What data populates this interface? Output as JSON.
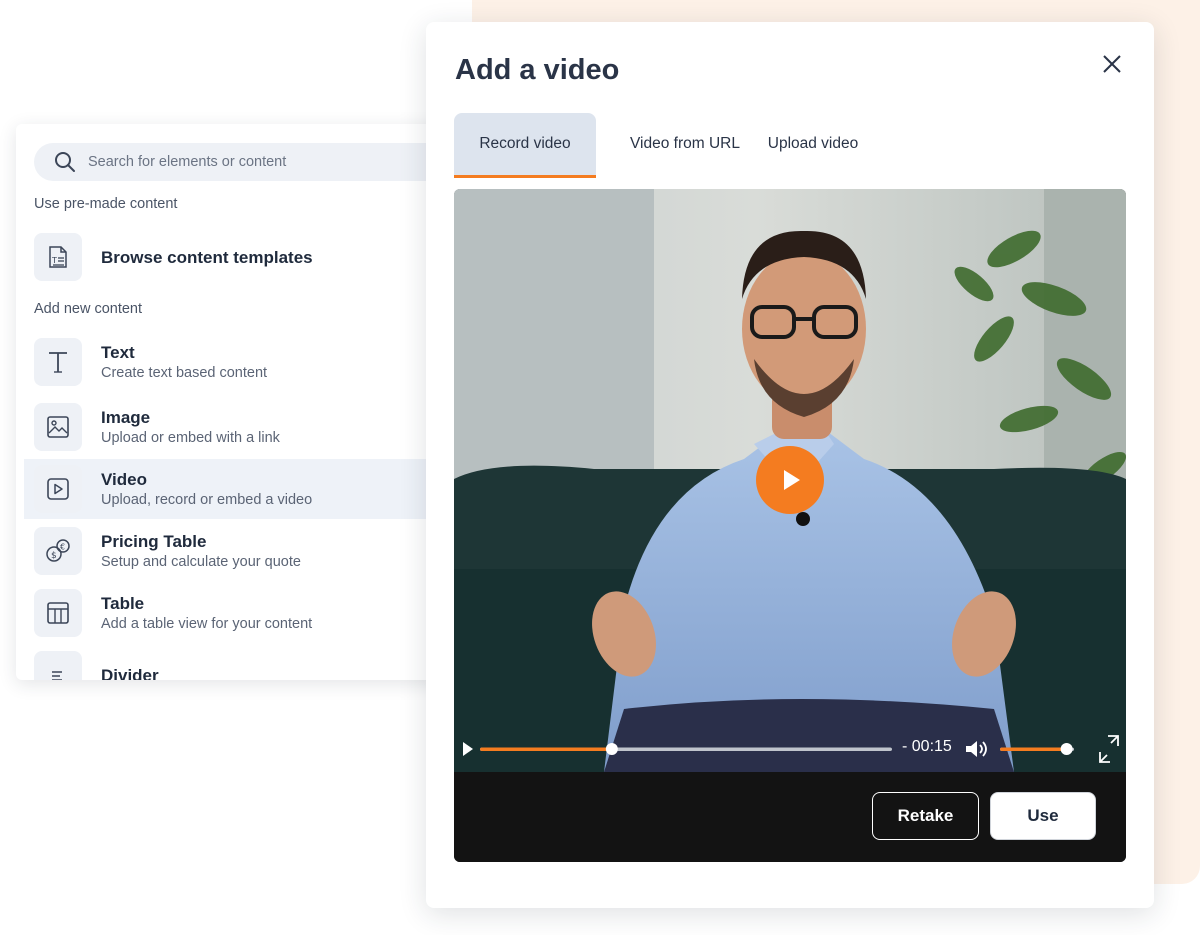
{
  "left_panel": {
    "search": {
      "placeholder": "Search for elements or content"
    },
    "premade_label": "Use pre-made content",
    "templates_label": "Browse content templates",
    "new_label": "Add new content",
    "items": [
      {
        "title": "Text",
        "desc": "Create text based content",
        "icon": "text-icon"
      },
      {
        "title": "Image",
        "desc": "Upload or embed with a link",
        "icon": "image-icon"
      },
      {
        "title": "Video",
        "desc": "Upload, record or embed a video",
        "icon": "video-icon"
      },
      {
        "title": "Pricing Table",
        "desc": "Setup and calculate your quote",
        "icon": "pricing-icon"
      },
      {
        "title": "Table",
        "desc": "Add a table view for your content",
        "icon": "table-icon"
      },
      {
        "title": "Divider",
        "desc": "",
        "icon": "divider-icon"
      }
    ]
  },
  "modal": {
    "title": "Add a video",
    "tabs": [
      {
        "label": "Record video",
        "active": true
      },
      {
        "label": "Video from URL",
        "active": false
      },
      {
        "label": "Upload video",
        "active": false
      }
    ],
    "player": {
      "time_remaining": "- 00:15",
      "progress": 0.32,
      "volume": 0.9
    },
    "buttons": {
      "retake": "Retake",
      "use": "Use"
    }
  },
  "colors": {
    "accent": "#f47c20",
    "panel_bg": "#eef1f6",
    "page_accent": "#fdf1e7"
  }
}
